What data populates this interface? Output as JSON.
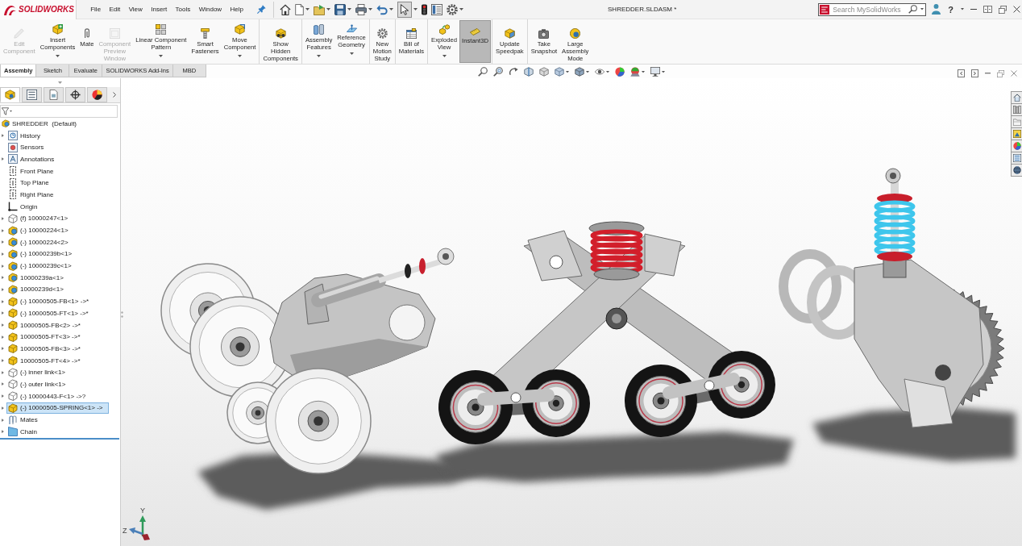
{
  "window": {
    "logo": "SOLIDWORKS",
    "menu": [
      "File",
      "Edit",
      "View",
      "Insert",
      "Tools",
      "Window",
      "Help"
    ],
    "select_tool": {
      "pressed": true
    },
    "title": "SHREDDER.SLDASM *",
    "search": {
      "placeholder": "Search MySolidWorks"
    },
    "help_label": "?"
  },
  "ribbon": {
    "groups": [
      [
        {
          "label": "Edit\nComponent",
          "disabled": true,
          "dropdown": false,
          "active": false
        },
        {
          "label": "Insert\nComponents",
          "disabled": false,
          "dropdown": true,
          "active": false
        },
        {
          "label": "Mate",
          "disabled": false,
          "dropdown": false,
          "active": false
        },
        {
          "label": "Component\nPreview\nWindow",
          "disabled": true,
          "dropdown": false,
          "active": false
        },
        {
          "label": "Linear Component\nPattern",
          "disabled": false,
          "dropdown": true,
          "active": false
        },
        {
          "label": "Smart\nFasteners",
          "disabled": false,
          "dropdown": false,
          "active": false
        },
        {
          "label": "Move\nComponent",
          "disabled": false,
          "dropdown": true,
          "active": false
        }
      ],
      [
        {
          "label": "Show\nHidden\nComponents",
          "disabled": false,
          "dropdown": false,
          "active": false
        }
      ],
      [
        {
          "label": "Assembly\nFeatures",
          "disabled": false,
          "dropdown": true,
          "active": false
        },
        {
          "label": "Reference\nGeometry",
          "disabled": false,
          "dropdown": true,
          "active": false
        }
      ],
      [
        {
          "label": "New\nMotion\nStudy",
          "disabled": false,
          "dropdown": false,
          "active": false
        }
      ],
      [
        {
          "label": "Bill of\nMaterials",
          "disabled": false,
          "dropdown": false,
          "active": false
        }
      ],
      [
        {
          "label": "Exploded\nView",
          "disabled": false,
          "dropdown": true,
          "active": false
        },
        {
          "label": "Instant3D",
          "disabled": false,
          "dropdown": false,
          "active": true
        }
      ],
      [
        {
          "label": "Update\nSpeedpak",
          "disabled": false,
          "dropdown": false,
          "active": false
        }
      ],
      [
        {
          "label": "Take\nSnapshot",
          "disabled": false,
          "dropdown": false,
          "active": false
        },
        {
          "label": "Large\nAssembly\nMode",
          "disabled": false,
          "dropdown": false,
          "active": false
        }
      ]
    ]
  },
  "tabs": [
    {
      "label": "Assembly",
      "selected": true
    },
    {
      "label": "Sketch",
      "selected": false
    },
    {
      "label": "Evaluate",
      "selected": false
    },
    {
      "label": "SOLIDWORKS Add-Ins",
      "selected": false
    },
    {
      "label": "MBD",
      "selected": false
    }
  ],
  "panel": {
    "tabs": [
      {
        "selected": true
      },
      {
        "selected": false
      },
      {
        "selected": false
      },
      {
        "selected": false
      },
      {
        "selected": false
      }
    ],
    "tree": {
      "label": "SHREDDER  (Default)",
      "kind": "assembly",
      "selected": false,
      "children": [
        {
          "label": "History",
          "kind": "history",
          "expandable": true,
          "selected": false
        },
        {
          "label": "Sensors",
          "kind": "sensors",
          "expandable": false,
          "selected": false
        },
        {
          "label": "Annotations",
          "kind": "annotations",
          "expandable": true,
          "selected": false
        },
        {
          "label": "Front Plane",
          "kind": "plane",
          "expandable": false,
          "selected": false
        },
        {
          "label": "Top Plane",
          "kind": "plane",
          "expandable": false,
          "selected": false
        },
        {
          "label": "Right Plane",
          "kind": "plane",
          "expandable": false,
          "selected": false
        },
        {
          "label": "Origin",
          "kind": "origin",
          "expandable": false,
          "selected": false
        },
        {
          "label": "(f) 10000247<1>",
          "kind": "hidden-part",
          "expandable": true,
          "selected": false
        },
        {
          "label": "(-) 10000224<1>",
          "kind": "assembly",
          "expandable": true,
          "selected": false
        },
        {
          "label": "(-) 10000224<2>",
          "kind": "assembly",
          "expandable": true,
          "selected": false
        },
        {
          "label": "(-) 10000239b<1>",
          "kind": "assembly",
          "expandable": true,
          "selected": false
        },
        {
          "label": "(-) 10000239c<1>",
          "kind": "assembly",
          "expandable": true,
          "selected": false
        },
        {
          "label": "10000239a<1>",
          "kind": "assembly",
          "expandable": true,
          "selected": false
        },
        {
          "label": "10000239d<1>",
          "kind": "assembly",
          "expandable": true,
          "selected": false
        },
        {
          "label": "(-) 10000505-FB<1> ->*",
          "kind": "part",
          "expandable": true,
          "selected": false
        },
        {
          "label": "(-) 10000505-FT<1> ->*",
          "kind": "part",
          "expandable": true,
          "selected": false
        },
        {
          "label": "10000505-FB<2> ->*",
          "kind": "part",
          "expandable": true,
          "selected": false
        },
        {
          "label": "10000505-FT<3> ->*",
          "kind": "part",
          "expandable": true,
          "selected": false
        },
        {
          "label": "10000505-FB<3> ->*",
          "kind": "part",
          "expandable": true,
          "selected": false
        },
        {
          "label": "10000505-FT<4> ->*",
          "kind": "part",
          "expandable": true,
          "selected": false
        },
        {
          "label": "(-) inner link<1>",
          "kind": "hidden-part",
          "expandable": true,
          "selected": false
        },
        {
          "label": "(-) outer link<1>",
          "kind": "hidden-part",
          "expandable": true,
          "selected": false
        },
        {
          "label": "(-) 10000443-F<1> ->?",
          "kind": "hidden-part",
          "expandable": true,
          "selected": false
        },
        {
          "label": "(-) 10000505-SPRING<1> ->",
          "kind": "part",
          "expandable": true,
          "selected": true
        },
        {
          "label": "Mates",
          "kind": "mates",
          "expandable": true,
          "selected": false
        },
        {
          "label": "Chain",
          "kind": "folder",
          "expandable": true,
          "selected": false
        }
      ]
    }
  },
  "viewport": {
    "axis_labels": [
      "Y",
      "Z"
    ]
  }
}
